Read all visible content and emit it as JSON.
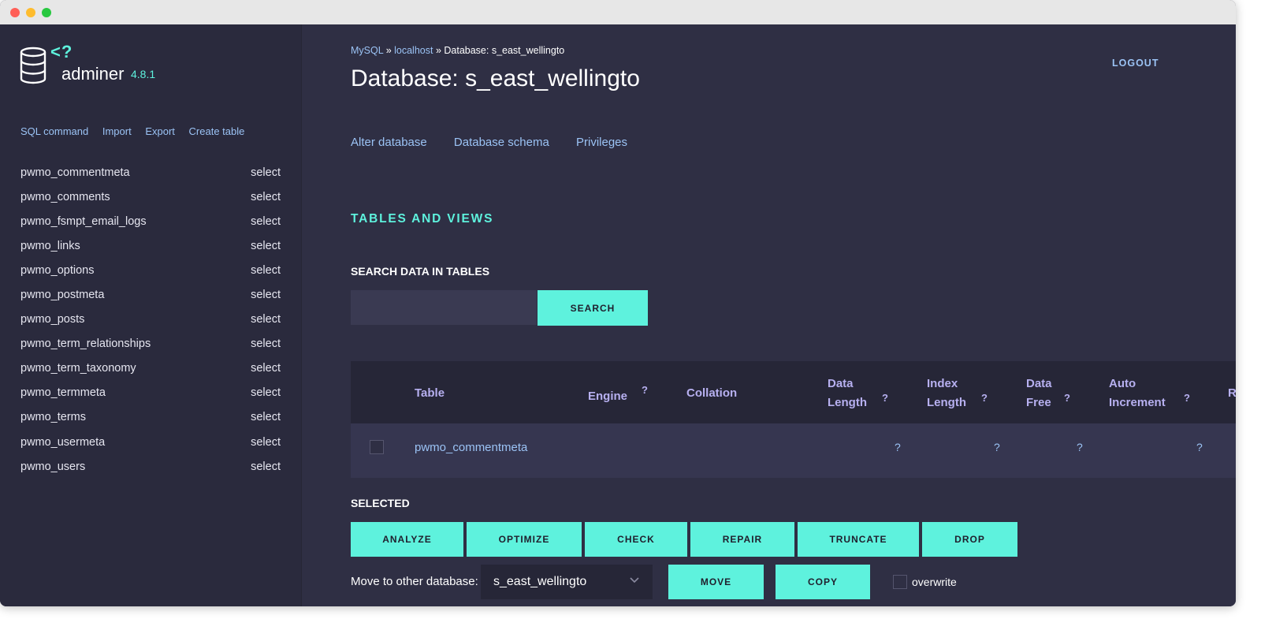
{
  "sidebar": {
    "logo_q": "<?",
    "app_name": "adminer",
    "version": "4.8.1",
    "links": [
      "SQL command",
      "Import",
      "Export",
      "Create table"
    ],
    "tables": [
      {
        "name": "pwmo_commentmeta",
        "action": "select"
      },
      {
        "name": "pwmo_comments",
        "action": "select"
      },
      {
        "name": "pwmo_fsmpt_email_logs",
        "action": "select"
      },
      {
        "name": "pwmo_links",
        "action": "select"
      },
      {
        "name": "pwmo_options",
        "action": "select"
      },
      {
        "name": "pwmo_postmeta",
        "action": "select"
      },
      {
        "name": "pwmo_posts",
        "action": "select"
      },
      {
        "name": "pwmo_term_relationships",
        "action": "select"
      },
      {
        "name": "pwmo_term_taxonomy",
        "action": "select"
      },
      {
        "name": "pwmo_termmeta",
        "action": "select"
      },
      {
        "name": "pwmo_terms",
        "action": "select"
      },
      {
        "name": "pwmo_usermeta",
        "action": "select"
      },
      {
        "name": "pwmo_users",
        "action": "select"
      }
    ]
  },
  "header": {
    "breadcrumb": {
      "mysql": "MySQL",
      "sep1": " » ",
      "host": "localhost",
      "sep2": " » ",
      "current": "Database: s_east_wellingto"
    },
    "title": "Database: s_east_wellingto",
    "logout": "LOGOUT"
  },
  "db_links": [
    "Alter database",
    "Database schema",
    "Privileges"
  ],
  "section_title": "TABLES AND VIEWS",
  "search": {
    "label": "SEARCH DATA IN TABLES",
    "value": "",
    "button": "SEARCH"
  },
  "table": {
    "headers": {
      "table": "Table",
      "engine": "Engine",
      "collation": "Collation",
      "data_length_1": "Data",
      "data_length_2": "Length",
      "index_length_1": "Index",
      "index_length_2": "Length",
      "data_free_1": "Data",
      "data_free_2": "Free",
      "auto_increment_1": "Auto",
      "auto_increment_2": "Increment",
      "rows_partial": "R"
    },
    "help_mark": "?",
    "rows": [
      {
        "name": "pwmo_commentmeta",
        "data_length": "?",
        "index_length": "?",
        "data_free": "?",
        "auto_increment": "?"
      }
    ]
  },
  "selected": {
    "label": "SELECTED",
    "buttons": [
      "ANALYZE",
      "OPTIMIZE",
      "CHECK",
      "REPAIR",
      "TRUNCATE",
      "DROP"
    ],
    "move_label": "Move to other database:",
    "target_db": "s_east_wellingto",
    "move_button": "MOVE",
    "copy_button": "COPY",
    "overwrite_label": "overwrite"
  },
  "colors": {
    "accent": "#5ef2dd",
    "link": "#9bc3f5",
    "header_text": "#b7b0f0",
    "background": "#2f2f44",
    "sidebar": "#2a2a3d"
  }
}
